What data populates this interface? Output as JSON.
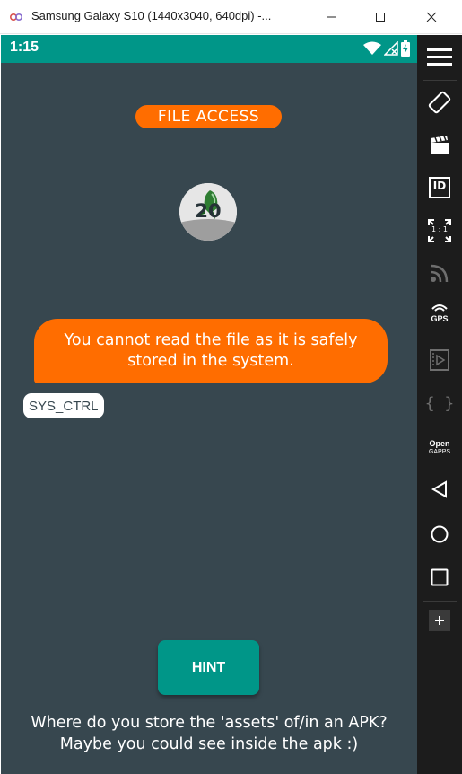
{
  "window": {
    "title": "Samsung Galaxy S10 (1440x3040, 640dpi) -...",
    "controls": [
      "minimize",
      "maximize",
      "close"
    ]
  },
  "statusbar": {
    "time": "1:15",
    "icons": [
      "wifi-icon",
      "no-signal-icon",
      "battery-charging-icon"
    ]
  },
  "app": {
    "title": "FILE ACCESS",
    "avatar_badge": "20",
    "message": "You cannot read the file as it is safely stored in the system.",
    "sender": "SYS_CTRL",
    "hint_button": "HINT",
    "hint_lines": [
      "Where do you store the 'assets' of/in an APK?",
      "Maybe you could see inside the apk :)"
    ]
  },
  "toolbar": {
    "items": [
      "menu",
      "rotate",
      "screen-record",
      "device-id",
      "resize",
      "cast",
      "gps",
      "media",
      "javascript",
      "opengapps",
      "back",
      "home",
      "overview",
      "more"
    ],
    "labels": {
      "resize": "1 : 1",
      "gps": "GPS",
      "id": "ID",
      "open_gapps": [
        "Open",
        "GAPPS"
      ],
      "braces": "{ }"
    }
  },
  "colors": {
    "screen_bg": "#37474f",
    "teal": "#009688",
    "orange": "#ff6d00",
    "toolbar_bg": "#1c1c1c"
  }
}
